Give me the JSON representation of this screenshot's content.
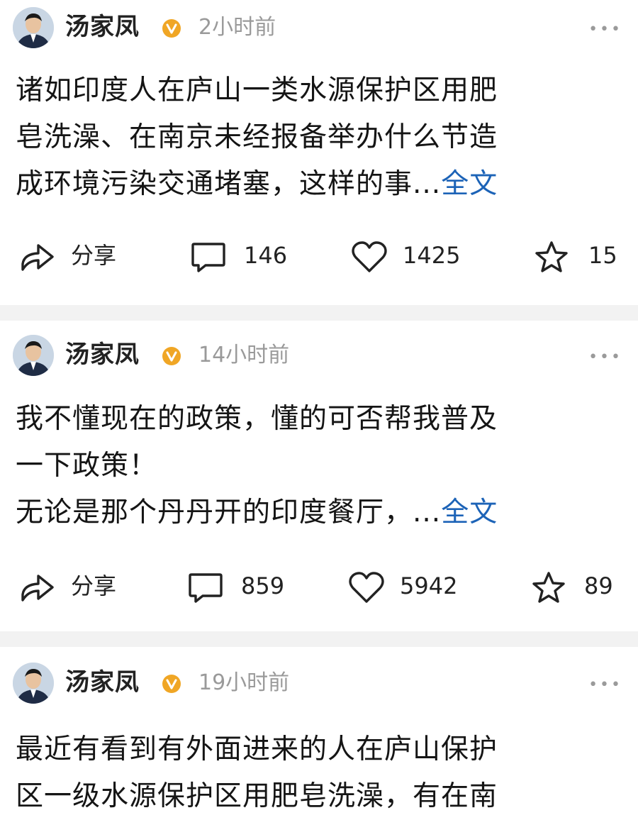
{
  "posts": [
    {
      "author": "汤家凤",
      "time": "2小时前",
      "more": "•••",
      "lines": [
        "诸如印度人在庐山一类水源保护区用肥",
        "皂洗澡、在南京未经报备举办什么节造",
        "成环境污染交通堵塞，这样的事..."
      ],
      "full_link": "全文",
      "share_label": "分享",
      "comments": "146",
      "likes": "1425",
      "favorites": "15"
    },
    {
      "author": "汤家凤",
      "time": "14小时前",
      "more": "•••",
      "lines": [
        "我不懂现在的政策，懂的可否帮我普及",
        "一下政策！",
        "无论是那个丹丹开的印度餐厅，..."
      ],
      "full_link": "全文",
      "share_label": "分享",
      "comments": "859",
      "likes": "5942",
      "favorites": "89"
    },
    {
      "author": "汤家凤",
      "time": "19小时前",
      "more": "•••",
      "lines": [
        "最近有看到有外面进来的人在庐山保护",
        "区一级水源保护区用肥皂洗澡，有在南"
      ]
    }
  ],
  "colors": {
    "link": "#1c63b7",
    "badge": "#f0a625",
    "meta": "#9a9a9a",
    "separator": "#f2f2f2"
  },
  "icons": {
    "avatar": "avatar-photo",
    "verified": "verified-badge-icon",
    "share": "share-arrow-icon",
    "comment": "comment-bubble-icon",
    "like": "heart-icon",
    "favorite": "star-icon",
    "more": "more-dots-icon"
  }
}
